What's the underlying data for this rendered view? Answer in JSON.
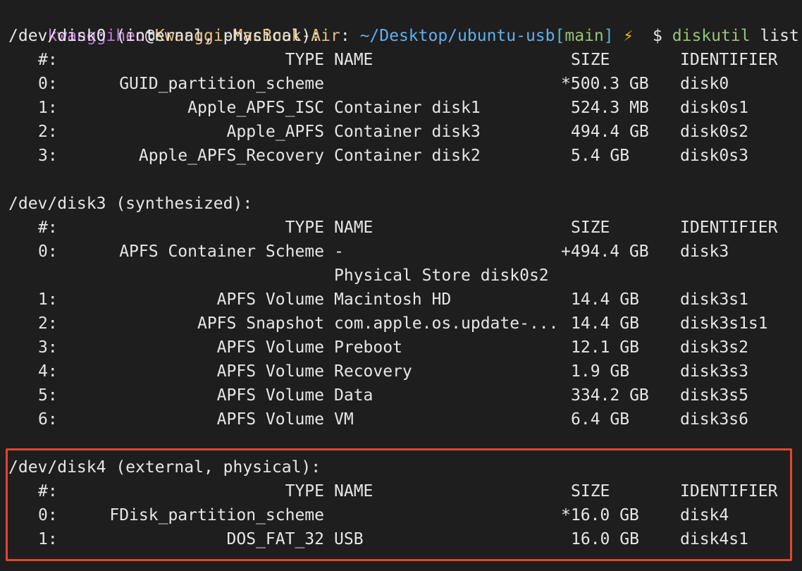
{
  "prompt": {
    "user": "kwanggiheo",
    "at": "@",
    "host": "Kwanggi-MacBook-Air",
    "colon": ":",
    "path": "~/Desktop/ubuntu-usb",
    "branch_open": "[",
    "branch": "main",
    "branch_close": "]",
    "bolt": "⚡",
    "dollar": "$",
    "command": "diskutil",
    "argument": "list"
  },
  "highlight": {
    "color": "#e2462c",
    "target": "disk4"
  },
  "headers": {
    "num": "#:",
    "type": "TYPE",
    "name": "NAME",
    "size": "SIZE",
    "identifier": "IDENTIFIER"
  },
  "disks": [
    {
      "title": "/dev/disk0 (internal, physical):",
      "rows": [
        {
          "num": "0:",
          "type": "GUID_partition_scheme",
          "name": "",
          "size": "*500.3 GB",
          "identifier": "disk0"
        },
        {
          "num": "1:",
          "type": "Apple_APFS_ISC",
          "name": "Container disk1",
          "size": "524.3 MB",
          "identifier": "disk0s1"
        },
        {
          "num": "2:",
          "type": "Apple_APFS",
          "name": "Container disk3",
          "size": "494.4 GB",
          "identifier": "disk0s2"
        },
        {
          "num": "3:",
          "type": "Apple_APFS_Recovery",
          "name": "Container disk2",
          "size": "5.4 GB",
          "identifier": "disk0s3"
        }
      ]
    },
    {
      "title": "/dev/disk3 (synthesized):",
      "rows": [
        {
          "num": "0:",
          "type": "APFS Container Scheme",
          "name": "-",
          "size": "+494.4 GB",
          "identifier": "disk3"
        },
        {
          "num": "",
          "type": "",
          "name": "Physical Store disk0s2",
          "size": "",
          "identifier": ""
        },
        {
          "num": "1:",
          "type": "APFS Volume",
          "name": "Macintosh HD",
          "size": "14.4 GB",
          "identifier": "disk3s1"
        },
        {
          "num": "2:",
          "type": "APFS Snapshot",
          "name": "com.apple.os.update-...",
          "size": "14.4 GB",
          "identifier": "disk3s1s1"
        },
        {
          "num": "3:",
          "type": "APFS Volume",
          "name": "Preboot",
          "size": "12.1 GB",
          "identifier": "disk3s2"
        },
        {
          "num": "4:",
          "type": "APFS Volume",
          "name": "Recovery",
          "size": "1.9 GB",
          "identifier": "disk3s3"
        },
        {
          "num": "5:",
          "type": "APFS Volume",
          "name": "Data",
          "size": "334.2 GB",
          "identifier": "disk3s5"
        },
        {
          "num": "6:",
          "type": "APFS Volume",
          "name": "VM",
          "size": "6.4 GB",
          "identifier": "disk3s6"
        }
      ]
    },
    {
      "title": "/dev/disk4 (external, physical):",
      "rows": [
        {
          "num": "0:",
          "type": "FDisk_partition_scheme",
          "name": "",
          "size": "*16.0 GB",
          "identifier": "disk4"
        },
        {
          "num": "1:",
          "type": "DOS_FAT_32",
          "name": "USB",
          "size": "16.0 GB",
          "identifier": "disk4s1"
        }
      ]
    }
  ]
}
